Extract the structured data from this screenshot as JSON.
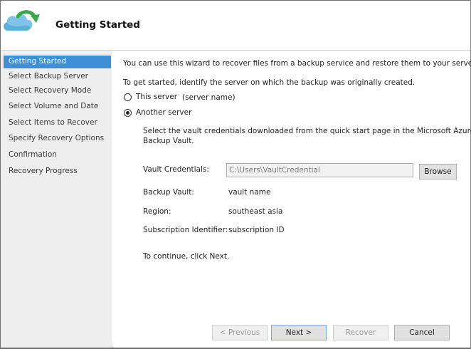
{
  "header": {
    "title": "Getting Started",
    "logo_icon": "cloud-refresh-icon"
  },
  "sidebar": {
    "items": [
      {
        "label": "Getting Started",
        "active": true
      },
      {
        "label": "Select Backup Server",
        "active": false
      },
      {
        "label": "Select Recovery Mode",
        "active": false
      },
      {
        "label": "Select Volume and Date",
        "active": false
      },
      {
        "label": "Select Items to Recover",
        "active": false
      },
      {
        "label": "Specify Recovery Options",
        "active": false
      },
      {
        "label": "Confirmation",
        "active": false
      },
      {
        "label": "Recovery Progress",
        "active": false
      }
    ]
  },
  "main": {
    "intro": "You can use this wizard to recover files from a backup service and restore them to your server.",
    "identify": "To get started, identify the server on which the backup was originally created.",
    "options": {
      "this_server_label": "This server",
      "this_server_name": "(server name)",
      "this_server_selected": false,
      "another_server_label": "Another server",
      "another_server_selected": true
    },
    "vault_instruction_line1": "Select the vault credentials downloaded from the quick start page in the Microsoft Azure",
    "vault_instruction_line2": "Backup Vault.",
    "vault_credentials_label": "Vault Credentials:",
    "vault_credentials_value": "C:\\Users\\VaultCredential",
    "browse_label": "Browse",
    "backup_vault_label": "Backup Vault:",
    "backup_vault_value": "vault name",
    "region_label": "Region:",
    "region_value": "southeast asia",
    "subscription_label": "Subscription Identifier:",
    "subscription_value": "subscription ID",
    "continue_text": "To continue, click Next."
  },
  "footer": {
    "previous_label": "< Previous",
    "next_label": "Next >",
    "recover_label": "Recover",
    "cancel_label": "Cancel"
  },
  "colors": {
    "accent": "#3d8fd6",
    "sidebar_bg": "#eeeeee",
    "logo_green": "#3aa84a",
    "logo_cloud": "#7fc4e8"
  }
}
